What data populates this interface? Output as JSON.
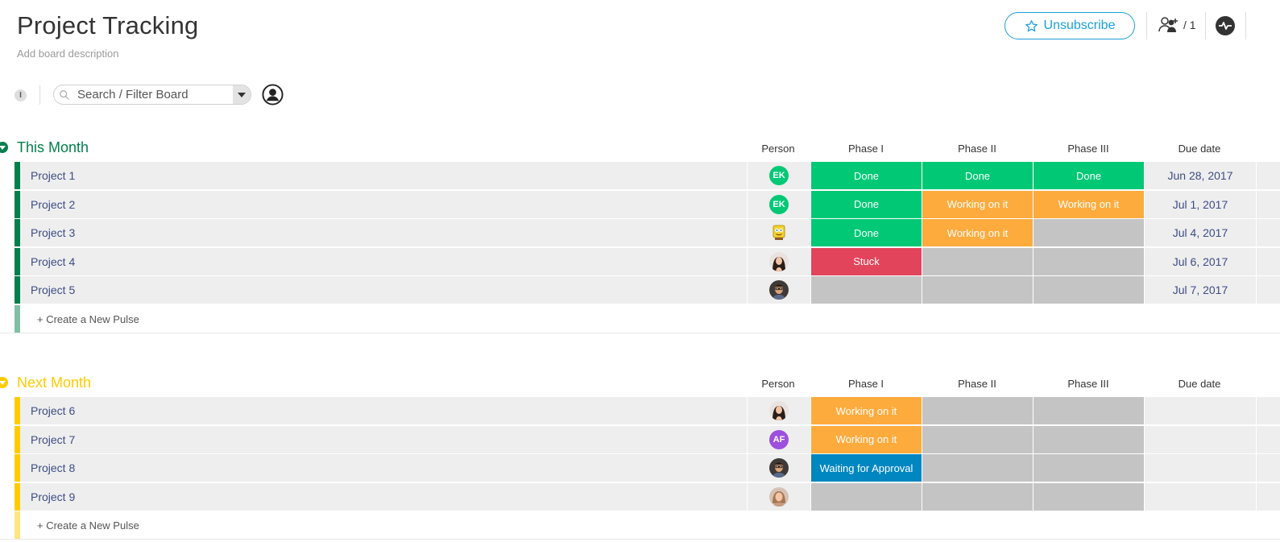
{
  "board": {
    "title": "Project Tracking",
    "description": "Add board description"
  },
  "header": {
    "unsubscribe_label": "Unsubscribe",
    "members_count": "/ 1",
    "accent_color": "#1a9fd8"
  },
  "filter": {
    "info_label": "I",
    "search_placeholder": "Search / Filter Board"
  },
  "columns": [
    "Person",
    "Phase I",
    "Phase II",
    "Phase III",
    "Due date"
  ],
  "status_colors": {
    "Done": "#00c875",
    "Working on it": "#fdab3d",
    "Stuck": "#e2445c",
    "Waiting for Approval": "#0086c0",
    "": "#c4c4c4"
  },
  "groups": [
    {
      "title": "This Month",
      "color": "#037f4c",
      "new_pulse_label": "+ Create a New Pulse",
      "rows": [
        {
          "name": "Project 1",
          "person": {
            "type": "initials",
            "text": "EK",
            "color": "#00c875"
          },
          "phases": [
            "Done",
            "Done",
            "Done"
          ],
          "due": "Jun 28, 2017"
        },
        {
          "name": "Project 2",
          "person": {
            "type": "initials",
            "text": "EK",
            "color": "#00c875"
          },
          "phases": [
            "Done",
            "Working on it",
            "Working on it"
          ],
          "due": "Jul 1, 2017"
        },
        {
          "name": "Project 3",
          "person": {
            "type": "photo",
            "icon": "sponge-avatar-icon",
            "color": "#f2d22e"
          },
          "phases": [
            "Done",
            "Working on it",
            ""
          ],
          "due": "Jul 4, 2017"
        },
        {
          "name": "Project 4",
          "person": {
            "type": "photo",
            "icon": "woman-avatar-icon",
            "color": "#3b2a26"
          },
          "phases": [
            "Stuck",
            "",
            ""
          ],
          "due": "Jul 6, 2017"
        },
        {
          "name": "Project 5",
          "person": {
            "type": "photo",
            "icon": "man-avatar-icon",
            "color": "#4a3b2c"
          },
          "phases": [
            "",
            "",
            ""
          ],
          "due": "Jul 7, 2017"
        }
      ]
    },
    {
      "title": "Next Month",
      "color": "#ffcb00",
      "new_pulse_label": "+ Create a New Pulse",
      "rows": [
        {
          "name": "Project 6",
          "person": {
            "type": "photo",
            "icon": "woman-avatar-icon",
            "color": "#3b2a26"
          },
          "phases": [
            "Working on it",
            "",
            ""
          ],
          "due": ""
        },
        {
          "name": "Project 7",
          "person": {
            "type": "initials",
            "text": "AF",
            "color": "#9d50dd"
          },
          "phases": [
            "Working on it",
            "",
            ""
          ],
          "due": ""
        },
        {
          "name": "Project 8",
          "person": {
            "type": "photo",
            "icon": "man-avatar-icon",
            "color": "#4a3b2c"
          },
          "phases": [
            "Waiting for Approval",
            "",
            ""
          ],
          "due": ""
        },
        {
          "name": "Project 9",
          "person": {
            "type": "photo",
            "icon": "woman-blonde-avatar-icon",
            "color": "#c9977a"
          },
          "phases": [
            "",
            "",
            ""
          ],
          "due": ""
        }
      ]
    }
  ]
}
